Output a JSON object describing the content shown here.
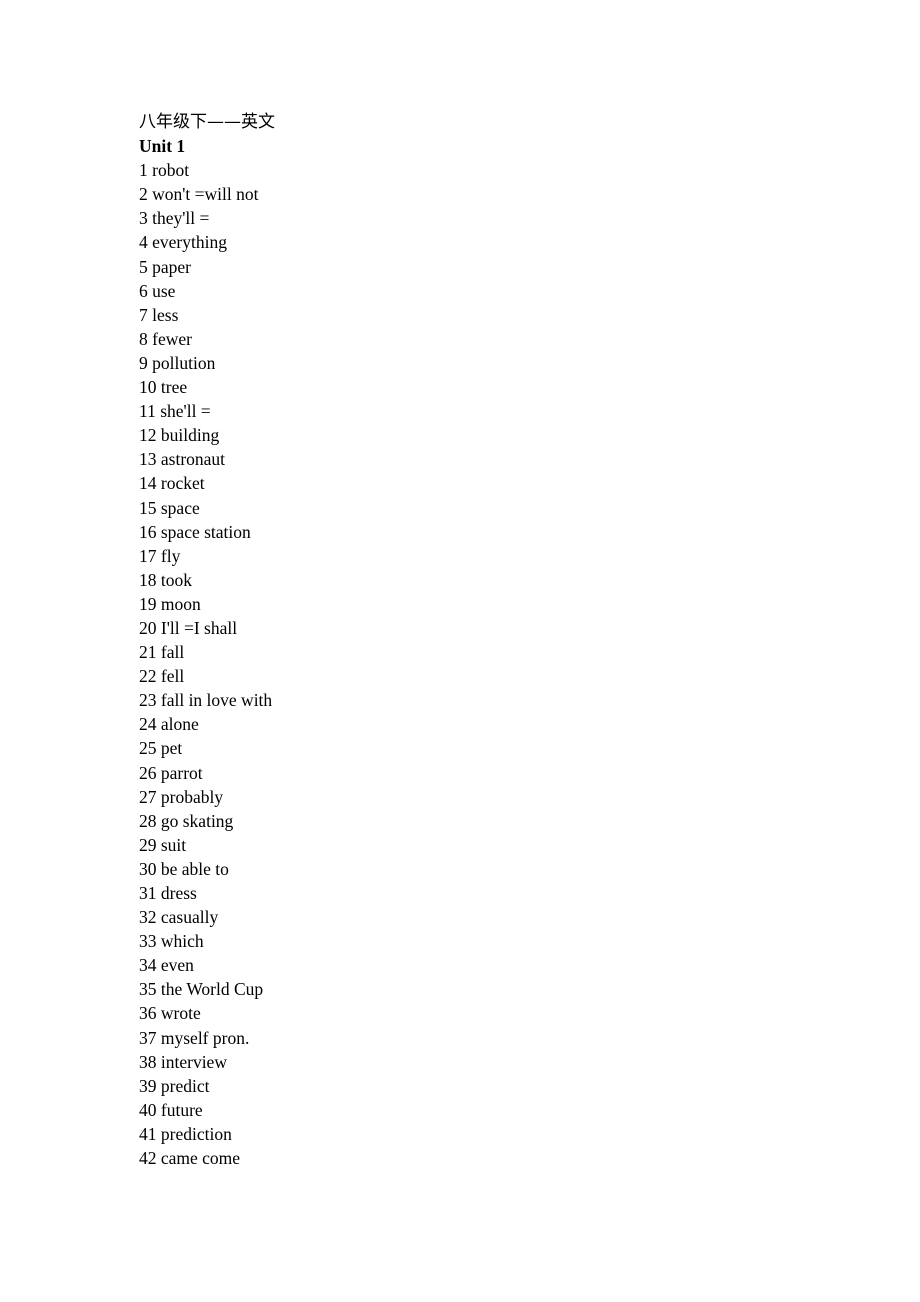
{
  "document": {
    "title": "八年级下——英文",
    "unit": "Unit 1",
    "items": [
      "1 robot",
      "2 won't =will not",
      "3 they'll =",
      "4 everything",
      "5 paper",
      "6 use",
      "7 less",
      "8 fewer",
      "9 pollution",
      "10 tree",
      "11 she'll =",
      "12 building",
      "13 astronaut",
      "14 rocket",
      "15 space",
      "16 space station",
      "17 fly",
      "18 took",
      "19 moon",
      "20 I'll =I shall",
      "21 fall",
      "22 fell",
      "23 fall in love with",
      "24 alone",
      "25 pet",
      "26 parrot",
      "27 probably",
      "28 go skating",
      "29 suit",
      "30 be able to",
      "31 dress",
      "32 casually",
      "33 which",
      "34 even",
      "35 the World Cup",
      "36 wrote",
      "37 myself pron.",
      "38 interview",
      "39 predict",
      "40 future",
      "41 prediction",
      "42 came come"
    ]
  }
}
